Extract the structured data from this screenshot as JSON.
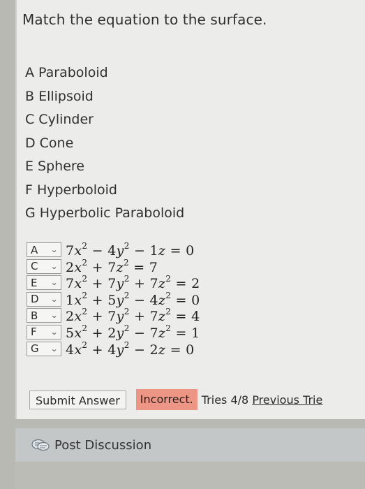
{
  "question": {
    "title": "Match the equation to the surface."
  },
  "options": [
    "A Paraboloid",
    "B Ellipsoid",
    "C Cylinder",
    "D Cone",
    "E Sphere",
    "F Hyperboloid",
    "G Hyperbolic Paraboloid"
  ],
  "rows": [
    {
      "selected": "A",
      "equation": "7x² − 4y² − 1z = 0"
    },
    {
      "selected": "C",
      "equation": "2x² + 7z² = 7"
    },
    {
      "selected": "E",
      "equation": "7x² + 7y² + 7z² = 2"
    },
    {
      "selected": "D",
      "equation": "1x² + 5y² − 4z² = 0"
    },
    {
      "selected": "B",
      "equation": "2x² + 7y² + 7z² = 4"
    },
    {
      "selected": "F",
      "equation": "5x² + 2y² − 7z² = 1"
    },
    {
      "selected": "G",
      "equation": "4x² + 4y² − 2z = 0"
    }
  ],
  "actions": {
    "submit_label": "Submit Answer",
    "status": "Incorrect.",
    "tries": "Tries 4/8",
    "previous_tries": "Previous Trie"
  },
  "discussion": {
    "label": "Post Discussion",
    "icon": "chat-bubbles-icon"
  },
  "colors": {
    "incorrect_bg": "#ee9685",
    "panel_bg": "#ececea",
    "outer_bg": "#b9b9b3"
  }
}
